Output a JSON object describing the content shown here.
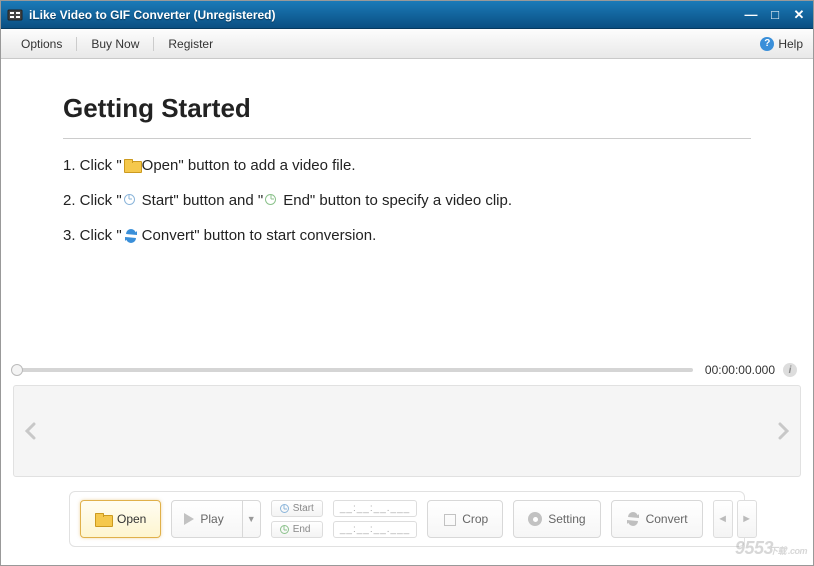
{
  "window": {
    "title": "iLike Video to GIF Converter (Unregistered)"
  },
  "menu": {
    "options": "Options",
    "buy_now": "Buy Now",
    "register": "Register",
    "help": "Help"
  },
  "getting_started": {
    "heading": "Getting Started",
    "s1a": "1. Click \" ",
    "s1b": " Open\" button to add a video file.",
    "s2a": "2. Click \" ",
    "s2b": " Start\" button and \" ",
    "s2c": " End\" button to specify a video clip.",
    "s3a": "3. Click \" ",
    "s3b": " Convert\" button to start conversion."
  },
  "timeline": {
    "time": "00:00:00.000"
  },
  "toolbar": {
    "open": "Open",
    "play": "Play",
    "start": "Start",
    "end": "End",
    "time_in": "__:__:__.___",
    "time_out": "__:__:__.___",
    "crop": "Crop",
    "setting": "Setting",
    "convert": "Convert"
  },
  "watermark": {
    "text": "9553",
    "sub": "下载\n.com"
  }
}
